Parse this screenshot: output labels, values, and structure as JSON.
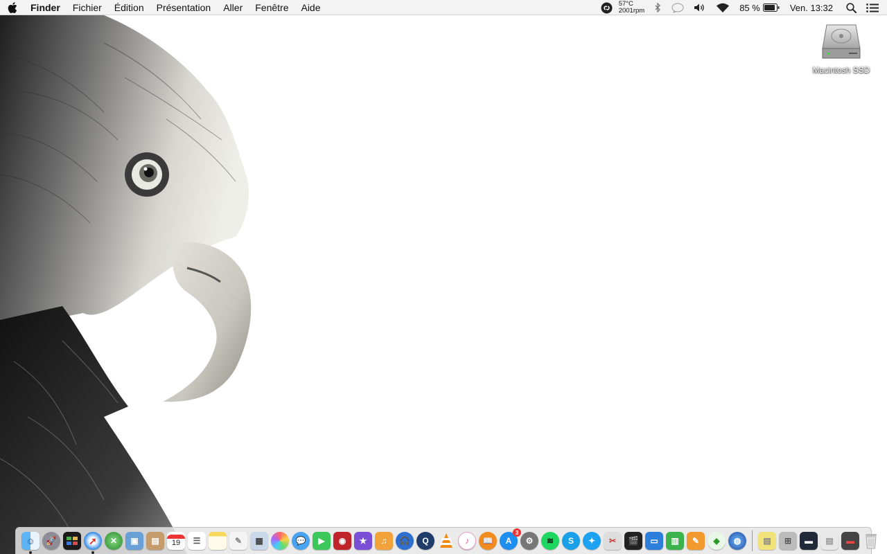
{
  "menubar": {
    "app_name": "Finder",
    "menus": [
      "Fichier",
      "Édition",
      "Présentation",
      "Aller",
      "Fenêtre",
      "Aide"
    ],
    "temperature": "57°C",
    "fan_speed": "2001rpm",
    "battery": "85 %",
    "clock": "Ven. 13:32"
  },
  "desktop": {
    "drive_label": "Macintosh SSD"
  },
  "dock": {
    "calendar_day": "19",
    "app_store_badge": "3"
  }
}
